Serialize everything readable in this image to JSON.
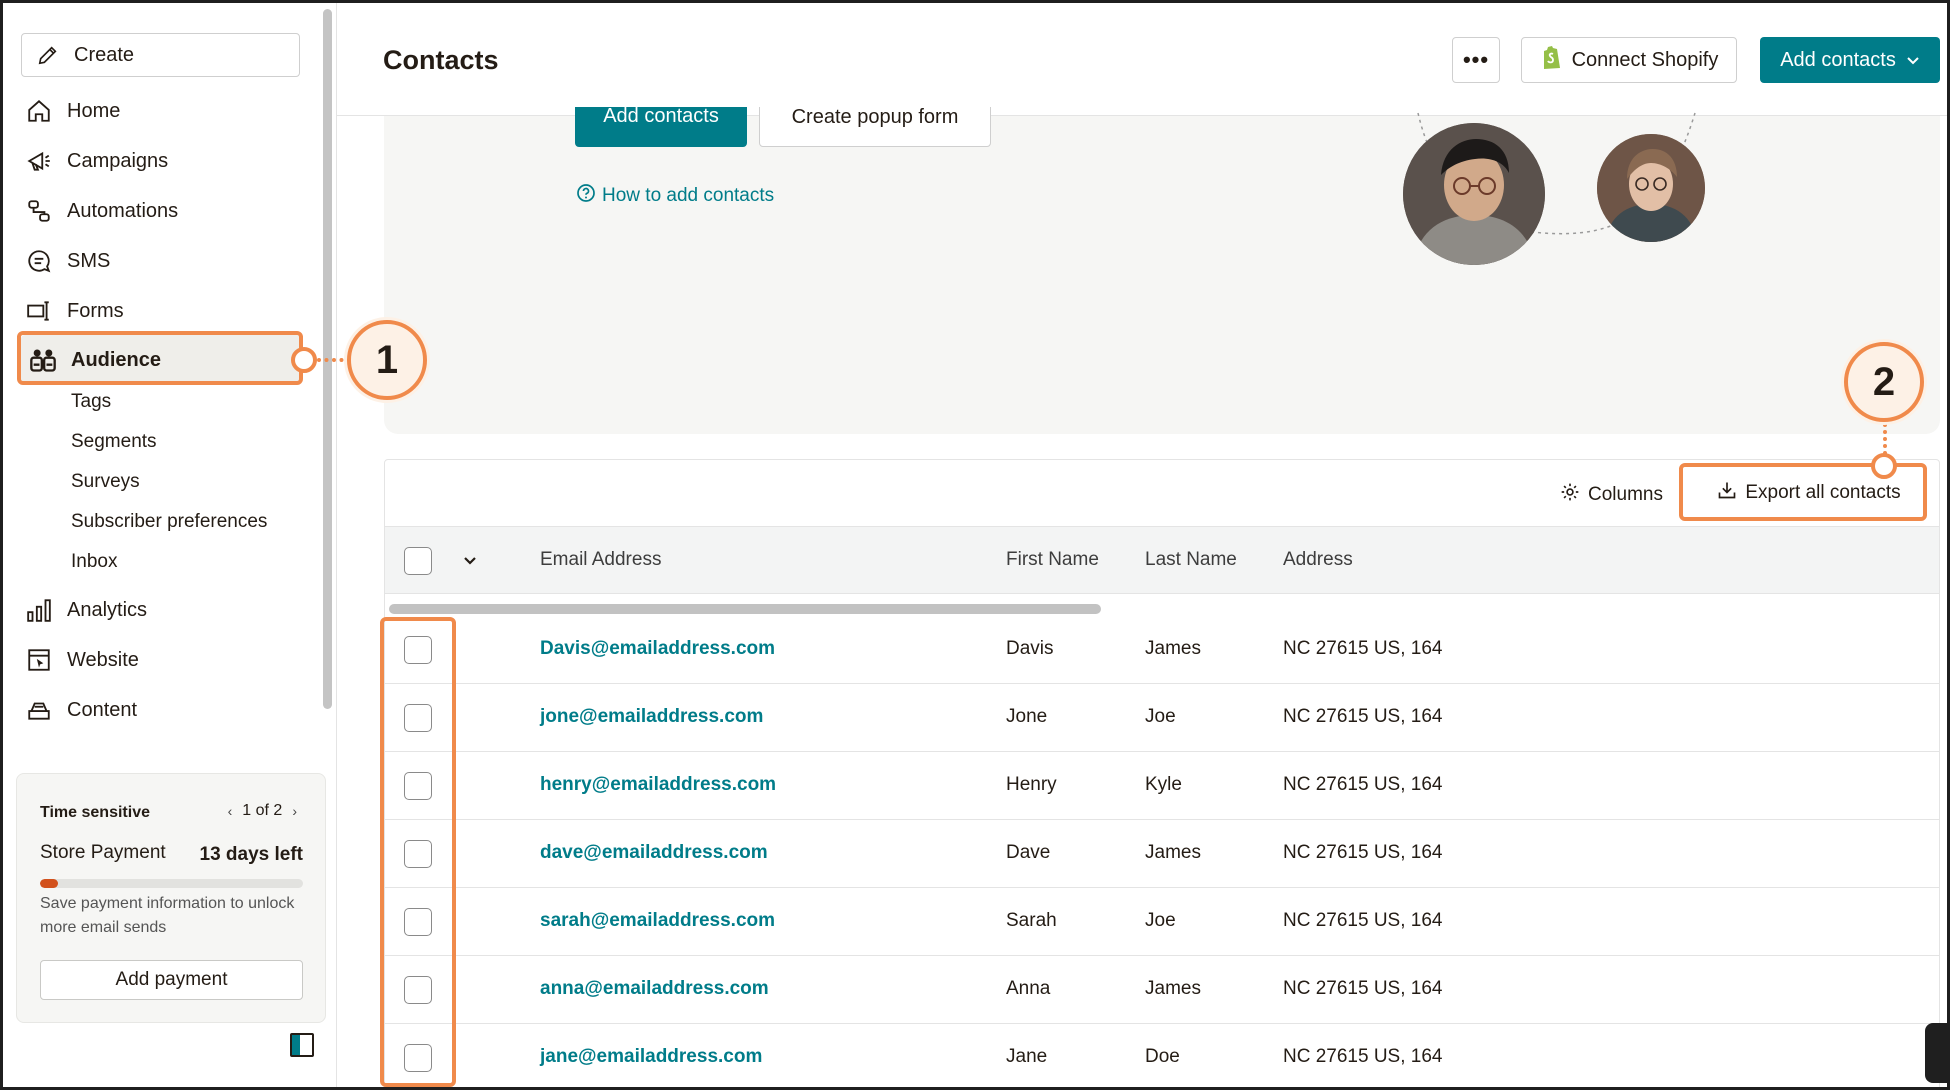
{
  "sidebar": {
    "create_label": "Create",
    "nav": [
      {
        "label": "Home",
        "icon": "home-icon"
      },
      {
        "label": "Campaigns",
        "icon": "megaphone-icon"
      },
      {
        "label": "Automations",
        "icon": "automation-icon"
      },
      {
        "label": "SMS",
        "icon": "sms-icon"
      },
      {
        "label": "Forms",
        "icon": "form-icon"
      },
      {
        "label": "Audience",
        "icon": "audience-icon",
        "active": true
      }
    ],
    "sub_items": [
      "Tags",
      "Segments",
      "Surveys",
      "Subscriber preferences",
      "Inbox"
    ],
    "nav_bottom": [
      {
        "label": "Analytics",
        "icon": "analytics-icon"
      },
      {
        "label": "Website",
        "icon": "website-icon"
      },
      {
        "label": "Content",
        "icon": "content-icon"
      }
    ],
    "promo": {
      "title": "Time sensitive",
      "pager": "1 of 2",
      "store_label": "Store Payment",
      "days_left": "13 days left",
      "progress": 0.07,
      "note": "Save payment information to unlock more email sends",
      "button": "Add payment"
    }
  },
  "header": {
    "title": "Contacts",
    "more_label": "•••",
    "shopify_label": "Connect Shopify",
    "add_contacts_label": "Add contacts"
  },
  "hero": {
    "add_contacts_label": "Add contacts",
    "popup_label": "Create popup form",
    "how_to_label": "How to add contacts"
  },
  "table": {
    "columns_label": "Columns",
    "export_label": "Export all contacts",
    "headers": [
      "Email Address",
      "First Name",
      "Last Name",
      "Address"
    ],
    "rows": [
      {
        "email": "Davis@emailaddress.com",
        "first": "Davis",
        "last": "James",
        "address": "NC 27615 US, 164"
      },
      {
        "email": "jone@emailaddress.com",
        "first": "Jone",
        "last": "Joe",
        "address": "NC 27615 US, 164"
      },
      {
        "email": "henry@emailaddress.com",
        "first": "Henry",
        "last": "Kyle",
        "address": "NC 27615 US, 164"
      },
      {
        "email": "dave@emailaddress.com",
        "first": "Dave",
        "last": "James",
        "address": "NC 27615 US, 164"
      },
      {
        "email": "sarah@emailaddress.com",
        "first": "Sarah",
        "last": "Joe",
        "address": "NC 27615 US, 164"
      },
      {
        "email": "anna@emailaddress.com",
        "first": "Anna",
        "last": "James",
        "address": "NC 27615 US, 164"
      },
      {
        "email": "jane@emailaddress.com",
        "first": "Jane",
        "last": "Doe",
        "address": "NC 27615 US, 164"
      }
    ]
  },
  "annotations": {
    "step1": "1",
    "step2": "2"
  },
  "colors": {
    "accent": "#007c89",
    "annotation": "#f08a4b",
    "progress": "#d2511c"
  }
}
